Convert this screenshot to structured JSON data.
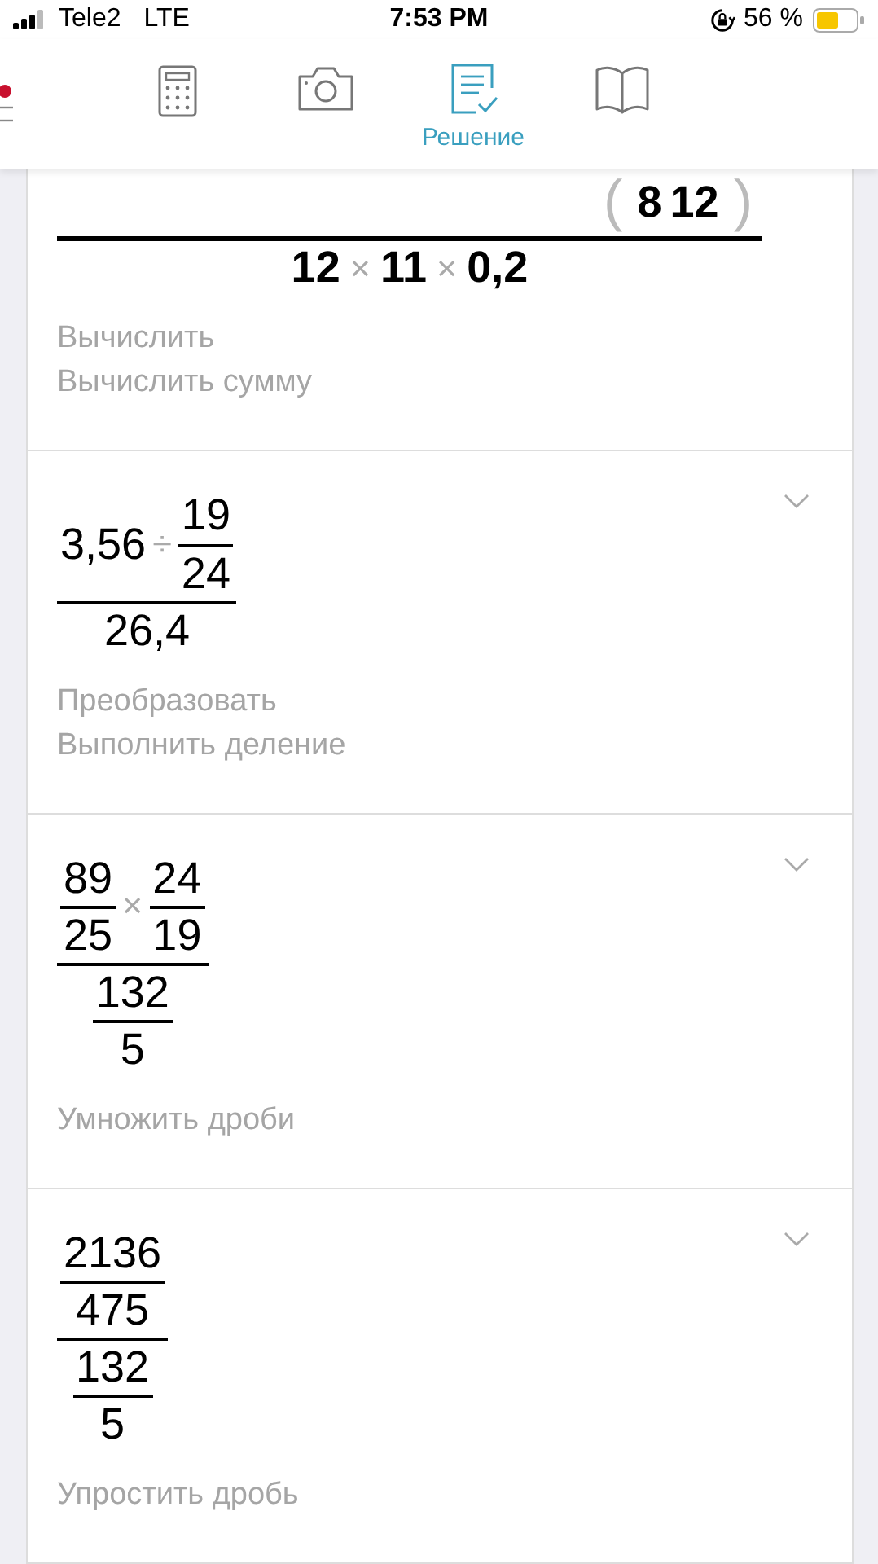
{
  "status_bar": {
    "carrier": "Tele2",
    "network": "LTE",
    "time": "7:53 PM",
    "battery": "56 %"
  },
  "tabs": [
    {
      "kind": "calculator",
      "selected": false
    },
    {
      "kind": "camera",
      "selected": false
    },
    {
      "kind": "solution",
      "label": "Решение",
      "selected": true
    },
    {
      "kind": "book",
      "selected": false
    }
  ],
  "steps": [
    {
      "bold": true,
      "collapsible": false,
      "expr": {
        "kind": "frac",
        "num": {
          "kind": "row",
          "items": [
            {
              "kind": "paren",
              "text": "("
            },
            {
              "kind": "num",
              "text": "8"
            },
            {
              "kind": "num",
              "text": "12"
            },
            {
              "kind": "paren",
              "text": ")"
            }
          ]
        },
        "den": {
          "kind": "row",
          "items": [
            {
              "kind": "num",
              "text": "12"
            },
            {
              "kind": "op",
              "text": "×"
            },
            {
              "kind": "num",
              "text": "11"
            },
            {
              "kind": "op",
              "text": "×"
            },
            {
              "kind": "num",
              "text": "0,2"
            }
          ]
        }
      },
      "hints": [
        "Вычислить",
        "Вычислить сумму"
      ]
    },
    {
      "bold": false,
      "collapsible": true,
      "expr": {
        "kind": "frac",
        "num": {
          "kind": "row",
          "items": [
            {
              "kind": "num",
              "text": "3,56"
            },
            {
              "kind": "op",
              "text": "÷"
            },
            {
              "kind": "frac",
              "num": {
                "kind": "num",
                "text": "19"
              },
              "den": {
                "kind": "num",
                "text": "24"
              }
            }
          ]
        },
        "den": {
          "kind": "num",
          "text": "26,4"
        }
      },
      "hints": [
        "Преобразовать",
        "Выполнить деление"
      ]
    },
    {
      "bold": false,
      "collapsible": true,
      "expr": {
        "kind": "frac",
        "num": {
          "kind": "row",
          "items": [
            {
              "kind": "frac",
              "num": {
                "kind": "num",
                "text": "89"
              },
              "den": {
                "kind": "num",
                "text": "25"
              }
            },
            {
              "kind": "op",
              "text": "×"
            },
            {
              "kind": "frac",
              "num": {
                "kind": "num",
                "text": "24"
              },
              "den": {
                "kind": "num",
                "text": "19"
              }
            }
          ]
        },
        "den": {
          "kind": "frac",
          "num": {
            "kind": "num",
            "text": "132"
          },
          "den": {
            "kind": "num",
            "text": "5"
          }
        }
      },
      "hints": [
        "Умножить дроби"
      ]
    },
    {
      "bold": false,
      "collapsible": true,
      "expr": {
        "kind": "frac",
        "num": {
          "kind": "frac",
          "num": {
            "kind": "num",
            "text": "2136"
          },
          "den": {
            "kind": "num",
            "text": "475"
          }
        },
        "den": {
          "kind": "frac",
          "num": {
            "kind": "num",
            "text": "132"
          },
          "den": {
            "kind": "num",
            "text": "5"
          }
        }
      },
      "hints": [
        "Упростить дробь"
      ]
    }
  ]
}
